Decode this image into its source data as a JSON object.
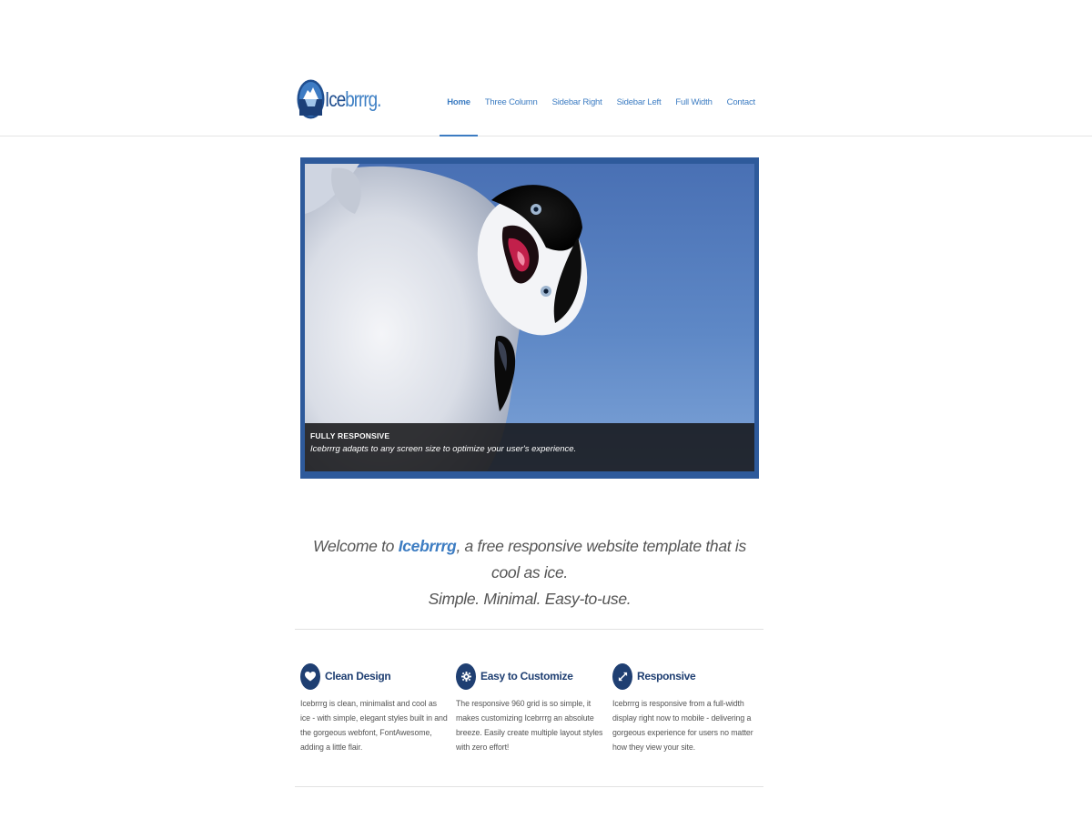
{
  "header": {
    "logo": {
      "text_main": "Ice",
      "text_accent": "brrrg."
    },
    "nav": [
      {
        "label": "Home",
        "active": true
      },
      {
        "label": "Three Column",
        "active": false
      },
      {
        "label": "Sidebar Right",
        "active": false
      },
      {
        "label": "Sidebar Left",
        "active": false
      },
      {
        "label": "Full Width",
        "active": false
      },
      {
        "label": "Contact",
        "active": false
      }
    ]
  },
  "slider": {
    "caption_title": "FULLY RESPONSIVE",
    "caption_text": "Icebrrrg adapts to any screen size to optimize your user's experience."
  },
  "welcome": {
    "prefix": "Welcome to ",
    "brand": "Icebrrrg",
    "suffix": ", a free responsive website template that is cool as ice.",
    "line2": "Simple. Minimal. Easy-to-use."
  },
  "features": [
    {
      "icon": "heart-icon",
      "title": "Clean Design",
      "text": "Icebrrrg is clean, minimalist and cool as ice - with simple, elegant styles built in and the gorgeous webfont, FontAwesome, adding a little flair."
    },
    {
      "icon": "gear-icon",
      "title": "Easy to Customize",
      "text": "The responsive 960 grid is so simple, it makes customizing Icebrrrg an absolute breeze. Easily create multiple layout styles with zero effort!"
    },
    {
      "icon": "expand-icon",
      "title": "Responsive",
      "text": "Icebrrrg is responsive from a full-width display right now to mobile - delivering a gorgeous experience for users no matter how they view your site."
    }
  ],
  "colors": {
    "accent": "#3c7cc2",
    "dark_blue": "#1f3f72",
    "slider_frame": "#2e5a9b"
  }
}
